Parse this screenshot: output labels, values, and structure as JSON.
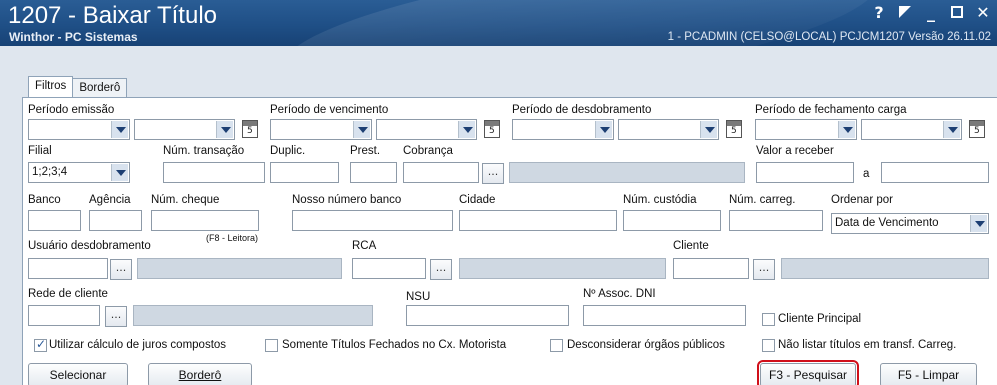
{
  "window": {
    "title": "1207 - Baixar Título",
    "subtitle": "Winthor - PC Sistemas",
    "status": "1 - PCADMIN (CELSO@LOCAL)   PCJCM1207   Versão 26.11.02",
    "buttons": {
      "help": "?",
      "minimize": "_",
      "close": "✕"
    }
  },
  "tabs": [
    {
      "label": "Filtros",
      "active": true
    },
    {
      "label": "Borderô",
      "active": false
    }
  ],
  "fields": {
    "periodo_emissao": {
      "label": "Período emissão",
      "value_from": "",
      "value_to": ""
    },
    "periodo_vencimento": {
      "label": "Período de vencimento",
      "value_from": "",
      "value_to": ""
    },
    "periodo_desdobramento": {
      "label": "Período de desdobramento",
      "value_from": "",
      "value_to": ""
    },
    "periodo_fechamento": {
      "label": "Período de fechamento carga",
      "value_from": "",
      "value_to": ""
    },
    "filial": {
      "label": "Filial",
      "value": "1;2;3;4"
    },
    "num_transacao": {
      "label": "Núm. transação",
      "value": ""
    },
    "duplic": {
      "label": "Duplic.",
      "value": ""
    },
    "prest": {
      "label": "Prest.",
      "value": ""
    },
    "cobranca": {
      "label": "Cobrança",
      "value": ""
    },
    "valor_receber": {
      "label": "Valor a receber",
      "separator": "a",
      "value_from": "",
      "value_to": ""
    },
    "banco": {
      "label": "Banco",
      "value": ""
    },
    "agencia": {
      "label": "Agência",
      "value": ""
    },
    "num_cheque": {
      "label": "Núm. cheque",
      "hint": "(F8 - Leitora)",
      "value": ""
    },
    "nosso_numero": {
      "label": "Nosso número banco",
      "value": ""
    },
    "cidade": {
      "label": "Cidade",
      "value": ""
    },
    "num_custodia": {
      "label": "Núm. custódia",
      "value": ""
    },
    "num_carreg": {
      "label": "Núm. carreg.",
      "value": ""
    },
    "ordenar_por": {
      "label": "Ordenar por",
      "value": "Data de Vencimento"
    },
    "usuario_desdobramento": {
      "label": "Usuário desdobramento",
      "value": ""
    },
    "rca": {
      "label": "RCA",
      "value": ""
    },
    "cliente": {
      "label": "Cliente",
      "value": ""
    },
    "rede_cliente": {
      "label": "Rede de cliente",
      "value": ""
    },
    "nsu": {
      "label": "NSU",
      "value": ""
    },
    "assoc_dni": {
      "label": "Nº Assoc. DNI",
      "value": ""
    },
    "ellipsis": "..."
  },
  "checkboxes": {
    "cliente_principal": {
      "label": "Cliente Principal",
      "checked": false
    },
    "juros_compostos": {
      "label": "Utilizar cálculo de juros compostos",
      "checked": true
    },
    "somente_fechados": {
      "label": "Somente Títulos Fechados no Cx. Motorista",
      "checked": false
    },
    "desconsiderar_orgaos": {
      "label": "Desconsiderar órgãos públicos",
      "checked": false
    },
    "nao_listar_transf": {
      "label": "Não listar títulos em transf. Carreg.",
      "checked": false
    }
  },
  "actions": {
    "selecionar": "Selecionar",
    "bordero": "Borderô",
    "pesquisar": "F3 - Pesquisar",
    "limpar": "F5 - Limpar"
  },
  "colors": {
    "titlebar": "#1f4f86",
    "highlight": "#d0101a",
    "gray_field": "#cfd8e2"
  }
}
